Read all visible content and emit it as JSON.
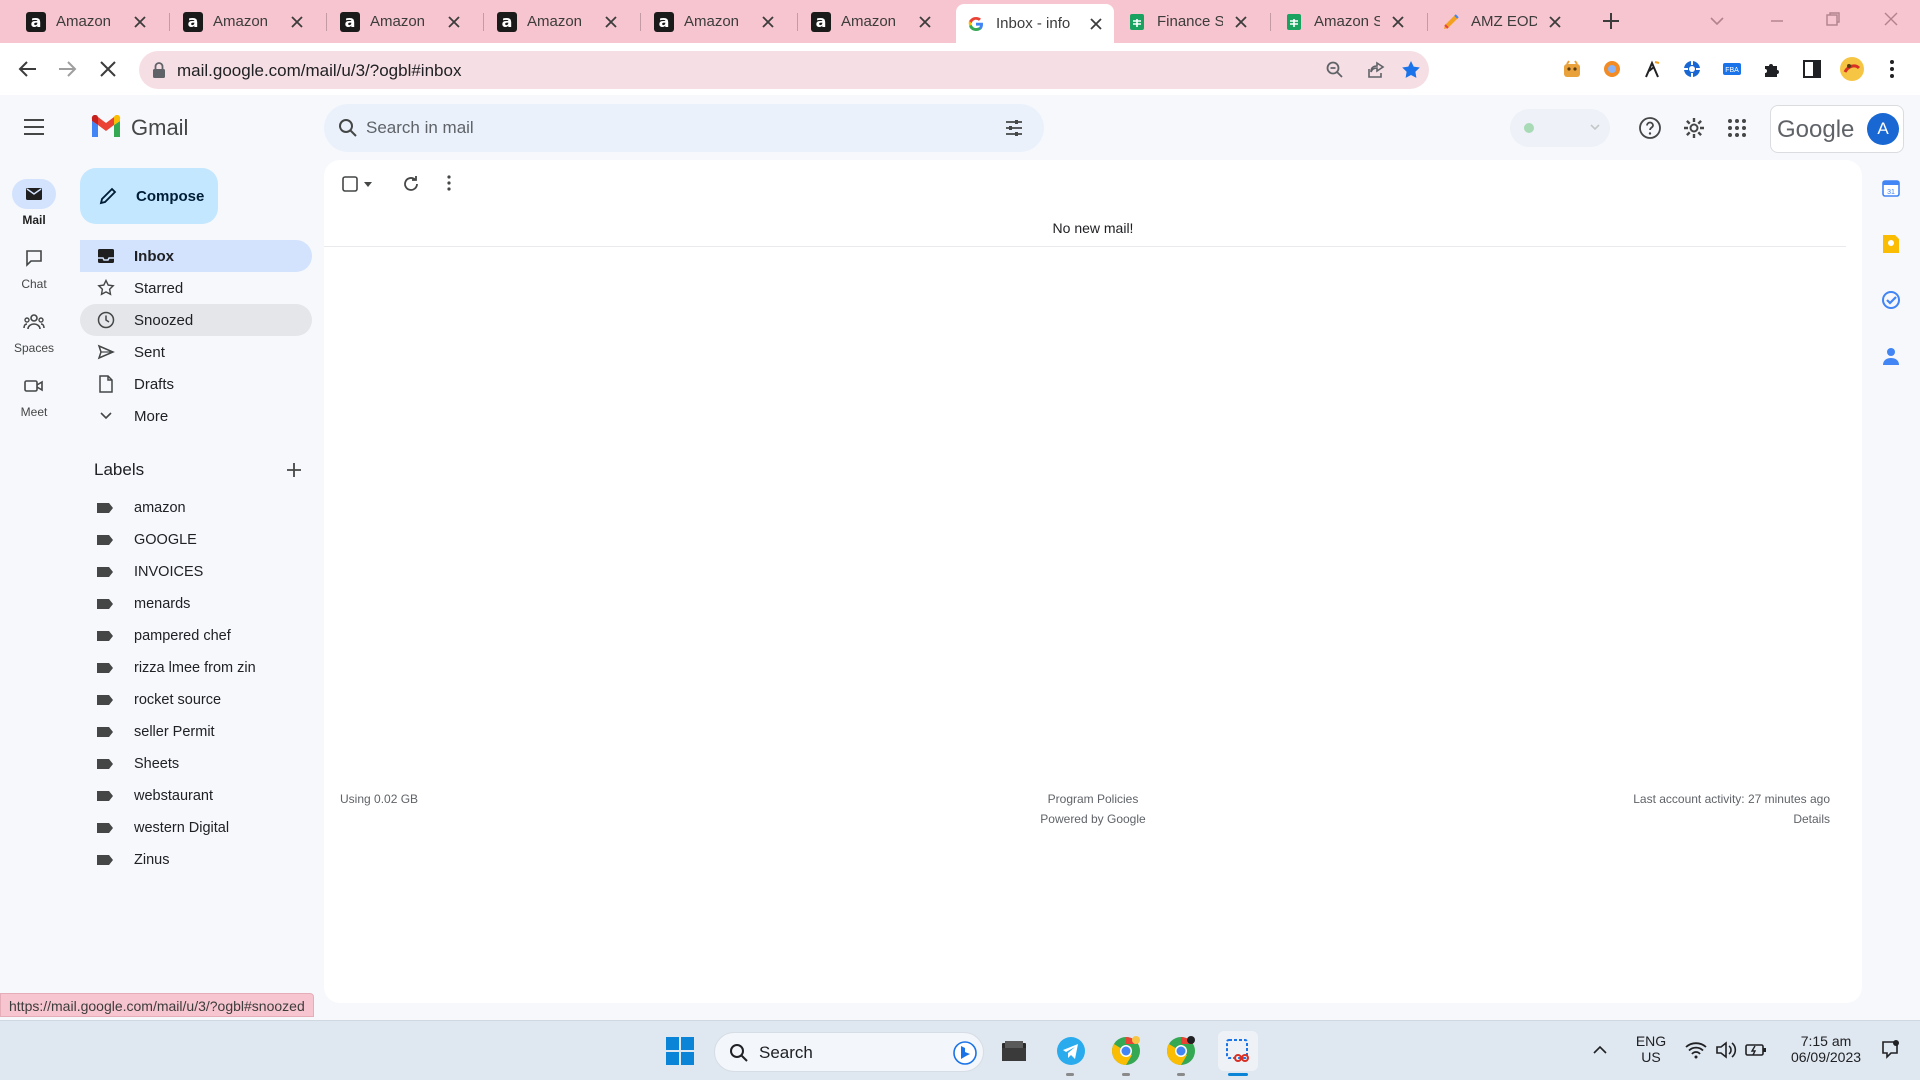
{
  "browser": {
    "tabs": [
      {
        "title": "Amazon",
        "icon": "amazon-icon"
      },
      {
        "title": "Amazon",
        "icon": "amazon-icon"
      },
      {
        "title": "Amazon",
        "icon": "amazon-icon"
      },
      {
        "title": "Amazon",
        "icon": "amazon-icon"
      },
      {
        "title": "Amazon",
        "icon": "amazon-icon"
      },
      {
        "title": "Amazon",
        "icon": "amazon-icon"
      },
      {
        "title": "Inbox - info",
        "icon": "gmail-icon",
        "active": true
      },
      {
        "title": "Finance She",
        "icon": "sheets-icon"
      },
      {
        "title": "Amazon St",
        "icon": "sheets-icon"
      },
      {
        "title": "AMZ EOD F",
        "icon": "pencil-app-icon"
      }
    ],
    "url": "mail.google.com/mail/u/3/?ogbl#inbox",
    "status_url": "https://mail.google.com/mail/u/3/?ogbl#snoozed",
    "accent_color": "#f7c5cf"
  },
  "gmail": {
    "app_name": "Gmail",
    "search_placeholder": "Search in mail",
    "google_text": "Google",
    "avatar_letter": "A",
    "rail": [
      {
        "label": "Mail"
      },
      {
        "label": "Chat"
      },
      {
        "label": "Spaces"
      },
      {
        "label": "Meet"
      }
    ],
    "compose_label": "Compose",
    "nav": [
      {
        "label": "Inbox"
      },
      {
        "label": "Starred"
      },
      {
        "label": "Snoozed"
      },
      {
        "label": "Sent"
      },
      {
        "label": "Drafts"
      },
      {
        "label": "More"
      }
    ],
    "labels_title": "Labels",
    "labels": [
      "amazon",
      "GOOGLE",
      "INVOICES",
      "menards",
      "pampered chef",
      "rizza lmee from zin",
      "rocket source",
      "seller Permit",
      "Sheets",
      "webstaurant",
      "western Digital",
      "Zinus"
    ],
    "empty_message": "No new mail!",
    "footer": {
      "storage": "Using 0.02 GB",
      "policies": "Program Policies",
      "powered": "Powered by Google",
      "activity": "Last account activity: 27 minutes ago",
      "details": "Details"
    }
  },
  "taskbar": {
    "search_label": "Search",
    "lang_line1": "ENG",
    "lang_line2": "US",
    "time": "7:15 am",
    "date": "06/09/2023"
  }
}
